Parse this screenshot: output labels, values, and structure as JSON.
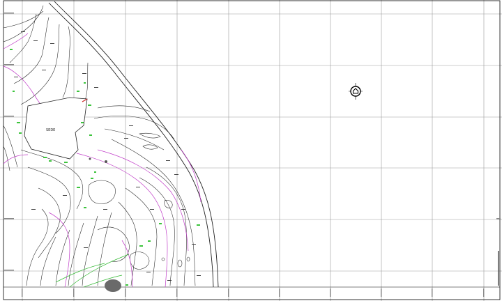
{
  "map": {
    "building_label": "SEDE",
    "north_symbol": "north-arrow-icon",
    "colors": {
      "grid": "#9a9a9a",
      "contour": "#222222",
      "contour_major": "#c03cc8",
      "vegetation": "#3cc43c",
      "background": "#ffffff"
    }
  }
}
